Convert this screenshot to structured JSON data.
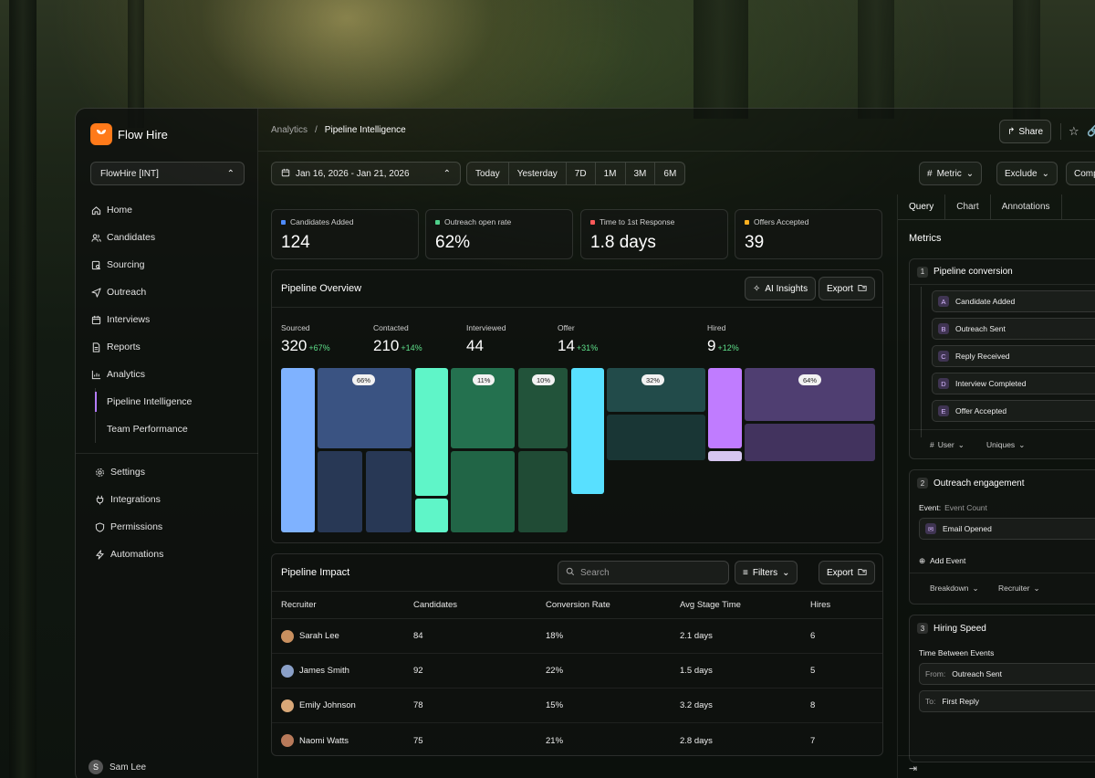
{
  "brand": {
    "name": "Flow Hire",
    "accent": "#ff7a1a"
  },
  "sidebar": {
    "org": "FlowHire [INT]",
    "items": [
      {
        "label": "Home",
        "icon": "home-icon"
      },
      {
        "label": "Candidates",
        "icon": "users-icon"
      },
      {
        "label": "Sourcing",
        "icon": "search-doc-icon"
      },
      {
        "label": "Outreach",
        "icon": "send-icon"
      },
      {
        "label": "Interviews",
        "icon": "calendar-icon"
      },
      {
        "label": "Reports",
        "icon": "document-icon"
      },
      {
        "label": "Analytics",
        "icon": "chart-icon"
      }
    ],
    "sub_items": [
      {
        "label": "Pipeline Intelligence"
      },
      {
        "label": "Team Performance"
      }
    ],
    "items2": [
      {
        "label": "Settings",
        "icon": "gear-icon"
      },
      {
        "label": "Integrations",
        "icon": "plug-icon"
      },
      {
        "label": "Permissions",
        "icon": "shield-icon"
      },
      {
        "label": "Automations",
        "icon": "bolt-icon"
      }
    ],
    "user": {
      "initial": "S",
      "name": "Sam Lee"
    }
  },
  "header": {
    "breadcrumb_root": "Analytics",
    "breadcrumb_sep": "/",
    "breadcrumb_current": "Pipeline Intelligence",
    "share_label": "Share"
  },
  "toolbar": {
    "date_range": "Jan 16, 2026 - Jan 21, 2026",
    "ranges": [
      "Today",
      "Yesterday",
      "7D",
      "1M",
      "3M",
      "6M"
    ],
    "metric_label": "Metric",
    "exclude_label": "Exclude",
    "compare_label": "Comp"
  },
  "kpis": [
    {
      "label": "Candidates Added",
      "value": "124",
      "color": "#4f8cff"
    },
    {
      "label": "Outreach open rate",
      "value": "62%",
      "color": "#4fd18b"
    },
    {
      "label": "Time to 1st Response",
      "value": "1.8 days",
      "color": "#ff5a5a"
    },
    {
      "label": "Offers Accepted",
      "value": "39",
      "color": "#ffb020"
    }
  ],
  "pipeline": {
    "title": "Pipeline Overview",
    "ai_label": "AI Insights",
    "export_label": "Export",
    "stages": [
      {
        "name": "Sourced",
        "value": "320",
        "delta": "+67%"
      },
      {
        "name": "Contacted",
        "value": "210",
        "delta": "+14%"
      },
      {
        "name": "Interviewed",
        "value": "44",
        "delta": ""
      },
      {
        "name": "Offer",
        "value": "14",
        "delta": "+31%"
      },
      {
        "name": "Hired",
        "value": "9",
        "delta": "+12%"
      }
    ],
    "pcts": [
      "66%",
      "11%",
      "10%",
      "32%",
      "64%"
    ]
  },
  "impact": {
    "title": "Pipeline Impact",
    "search_placeholder": "Search",
    "filters_label": "Filters",
    "export_label": "Export",
    "columns": [
      "Recruiter",
      "Candidates",
      "Conversion Rate",
      "Avg Stage Time",
      "Hires"
    ],
    "rows": [
      {
        "name": "Sarah Lee",
        "candidates": "84",
        "conversion": "18%",
        "avg": "2.1 days",
        "hires": "6",
        "avatar": "#c9905f"
      },
      {
        "name": "James Smith",
        "candidates": "92",
        "conversion": "22%",
        "avg": "1.5 days",
        "hires": "5",
        "avatar": "#8aa0c8"
      },
      {
        "name": "Emily Johnson",
        "candidates": "78",
        "conversion": "15%",
        "avg": "3.2 days",
        "hires": "8",
        "avatar": "#d9a878"
      },
      {
        "name": "Naomi Watts",
        "candidates": "75",
        "conversion": "21%",
        "avg": "2.8 days",
        "hires": "7",
        "avatar": "#b87a5a"
      }
    ]
  },
  "right_panel": {
    "tabs": [
      "Query",
      "Chart",
      "Annotations"
    ],
    "metrics_title": "Metrics",
    "metric1": {
      "num": "1",
      "title": "Pipeline conversion",
      "events": [
        {
          "letter": "A",
          "label": "Candidate Added"
        },
        {
          "letter": "B",
          "label": "Outreach Sent"
        },
        {
          "letter": "C",
          "label": "Reply Received"
        },
        {
          "letter": "D",
          "label": "Interview Completed"
        },
        {
          "letter": "E",
          "label": "Offer Accepted"
        }
      ],
      "user_label": "User",
      "uniques_label": "Uniques"
    },
    "metric2": {
      "num": "2",
      "title": "Outreach engagement",
      "event_label": "Event:",
      "event_value": "Event Count",
      "event_name": "Email Opened",
      "add_event": "Add Event",
      "breakdown": "Breakdown",
      "recruiter": "Recruiter"
    },
    "metric3": {
      "num": "3",
      "title": "Hiring Speed",
      "subtitle": "Time Between Events",
      "from_label": "From:",
      "from_value": "Outreach Sent",
      "to_label": "To:",
      "to_value": "First Reply"
    }
  }
}
